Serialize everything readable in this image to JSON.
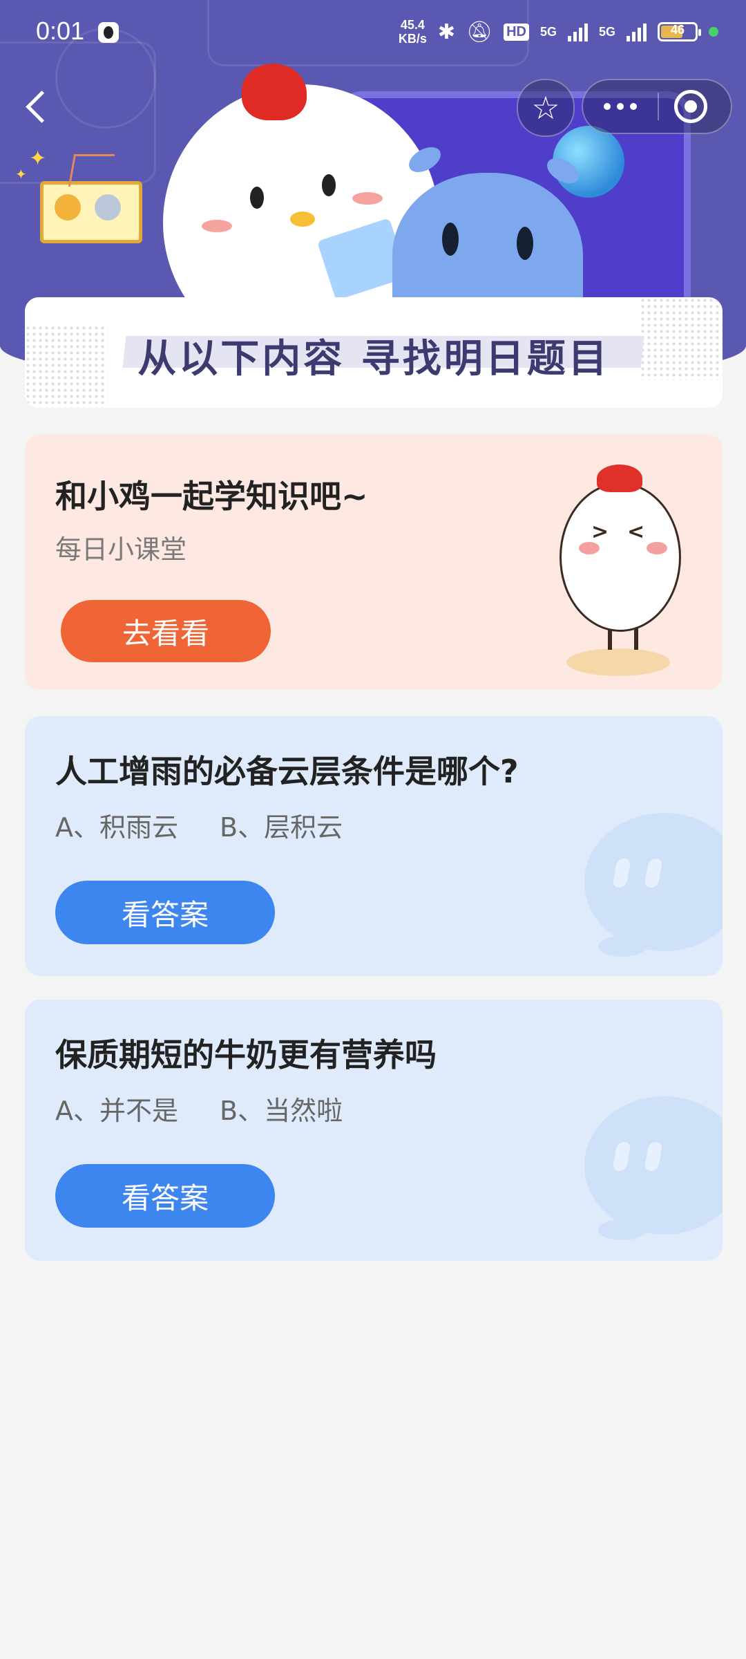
{
  "status_bar": {
    "time": "0:01",
    "net_speed_value": "45.4",
    "net_speed_unit": "KB/s",
    "hd_label": "HD",
    "network_1": "5G",
    "network_2": "5G",
    "battery": "46"
  },
  "banner": {
    "title": "从以下内容  寻找明日题目"
  },
  "learn_card": {
    "title": "和小鸡一起学知识吧~",
    "subtitle": "每日小课堂",
    "button_label": "去看看"
  },
  "questions": [
    {
      "title": "人工增雨的必备云层条件是哪个?",
      "option_a": "A、积雨云",
      "option_b": "B、层积云",
      "button_label": "看答案"
    },
    {
      "title": "保质期短的牛奶更有营养吗",
      "option_a": "A、并不是",
      "option_b": "B、当然啦",
      "button_label": "看答案"
    }
  ],
  "colors": {
    "header_bg": "#5a58b0",
    "accent_orange": "#ef6536",
    "accent_blue": "#3e86ef",
    "card_orange_bg": "#fde9e1",
    "card_blue_bg": "#dfebfb"
  },
  "icons": {
    "back": "back-arrow-icon",
    "favorite": "star-icon",
    "more": "more-dots-icon",
    "close": "target-close-icon"
  }
}
